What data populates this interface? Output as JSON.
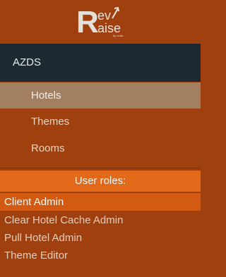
{
  "logo": {
    "line1": "ev",
    "line2": "aise",
    "letter": "R",
    "tagline": "by onda"
  },
  "section": {
    "title": "AZDS"
  },
  "nav": {
    "items": [
      {
        "label": "Hotels",
        "active": true
      },
      {
        "label": "Themes",
        "active": false
      },
      {
        "label": "Rooms",
        "active": false
      }
    ]
  },
  "roles": {
    "header": "User roles:",
    "items": [
      {
        "label": "Client Admin",
        "selected": true
      },
      {
        "label": "Clear Hotel Cache Admin",
        "selected": false
      },
      {
        "label": "Pull Hotel Admin",
        "selected": false
      },
      {
        "label": "Theme Editor",
        "selected": false
      }
    ]
  },
  "colors": {
    "background": "#A0400F",
    "header_dark": "#1E2A32",
    "active_nav": "#A37F62",
    "roles_header": "#E2681A",
    "selected_role": "#D35A12"
  }
}
